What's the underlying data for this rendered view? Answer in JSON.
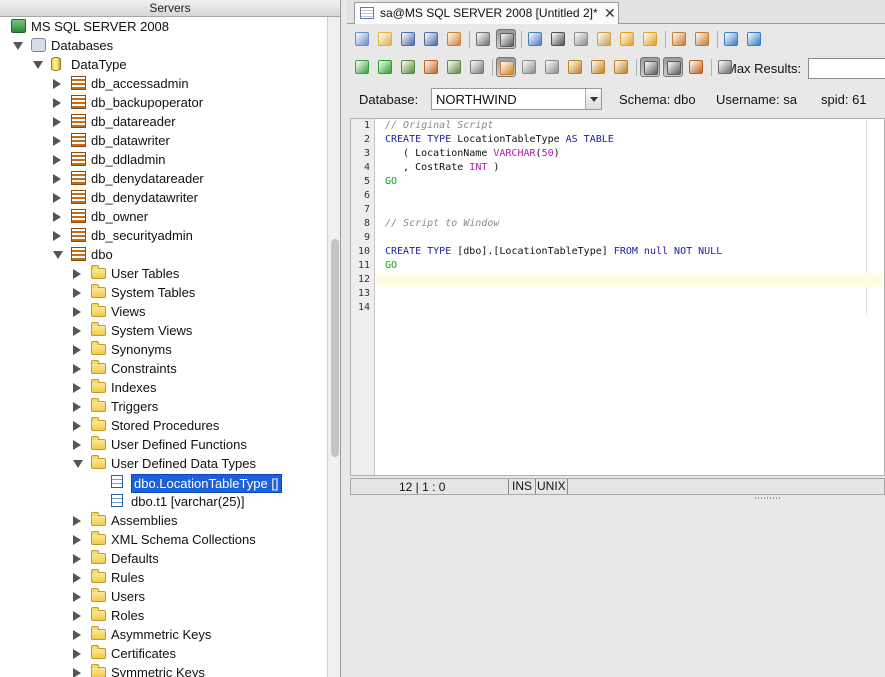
{
  "servers_panel": {
    "title": "Servers",
    "tree": [
      {
        "label": "MS SQL SERVER 2008",
        "level": 0,
        "toggle": "none",
        "icon": "server-icon"
      },
      {
        "label": "Databases",
        "level": 1,
        "toggle": "open",
        "icon": "databases-icon"
      },
      {
        "label": "DataType",
        "level": 2,
        "toggle": "open",
        "icon": "database-icon"
      },
      {
        "label": "db_accessadmin",
        "level": 3,
        "toggle": "closed",
        "icon": "schema-icon"
      },
      {
        "label": "db_backupoperator",
        "level": 3,
        "toggle": "closed",
        "icon": "schema-icon"
      },
      {
        "label": "db_datareader",
        "level": 3,
        "toggle": "closed",
        "icon": "schema-icon"
      },
      {
        "label": "db_datawriter",
        "level": 3,
        "toggle": "closed",
        "icon": "schema-icon"
      },
      {
        "label": "db_ddladmin",
        "level": 3,
        "toggle": "closed",
        "icon": "schema-icon"
      },
      {
        "label": "db_denydatareader",
        "level": 3,
        "toggle": "closed",
        "icon": "schema-icon"
      },
      {
        "label": "db_denydatawriter",
        "level": 3,
        "toggle": "closed",
        "icon": "schema-icon"
      },
      {
        "label": "db_owner",
        "level": 3,
        "toggle": "closed",
        "icon": "schema-icon"
      },
      {
        "label": "db_securityadmin",
        "level": 3,
        "toggle": "closed",
        "icon": "schema-icon"
      },
      {
        "label": "dbo",
        "level": 3,
        "toggle": "open",
        "icon": "schema-icon"
      },
      {
        "label": "User Tables",
        "level": 4,
        "toggle": "closed",
        "icon": "folder-icon"
      },
      {
        "label": "System Tables",
        "level": 4,
        "toggle": "closed",
        "icon": "folder-icon"
      },
      {
        "label": "Views",
        "level": 4,
        "toggle": "closed",
        "icon": "folder-icon"
      },
      {
        "label": "System Views",
        "level": 4,
        "toggle": "closed",
        "icon": "folder-icon"
      },
      {
        "label": "Synonyms",
        "level": 4,
        "toggle": "closed",
        "icon": "folder-icon"
      },
      {
        "label": "Constraints",
        "level": 4,
        "toggle": "closed",
        "icon": "folder-icon"
      },
      {
        "label": "Indexes",
        "level": 4,
        "toggle": "closed",
        "icon": "folder-icon"
      },
      {
        "label": "Triggers",
        "level": 4,
        "toggle": "closed",
        "icon": "folder-icon"
      },
      {
        "label": "Stored Procedures",
        "level": 4,
        "toggle": "closed",
        "icon": "folder-icon"
      },
      {
        "label": "User Defined Functions",
        "level": 4,
        "toggle": "closed",
        "icon": "folder-icon"
      },
      {
        "label": "User Defined Data Types",
        "level": 4,
        "toggle": "open",
        "icon": "folder-icon"
      },
      {
        "label": "dbo.LocationTableType []",
        "level": 5,
        "toggle": "none",
        "icon": "data-type-icon",
        "selected": true
      },
      {
        "label": "dbo.t1 [varchar(25)]",
        "level": 5,
        "toggle": "none",
        "icon": "data-type-icon"
      },
      {
        "label": "Assemblies",
        "level": 4,
        "toggle": "closed",
        "icon": "folder-icon"
      },
      {
        "label": "XML Schema Collections",
        "level": 4,
        "toggle": "closed",
        "icon": "folder-icon"
      },
      {
        "label": "Defaults",
        "level": 4,
        "toggle": "closed",
        "icon": "folder-icon"
      },
      {
        "label": "Rules",
        "level": 4,
        "toggle": "closed",
        "icon": "folder-icon"
      },
      {
        "label": "Users",
        "level": 4,
        "toggle": "closed",
        "icon": "folder-icon"
      },
      {
        "label": "Roles",
        "level": 4,
        "toggle": "closed",
        "icon": "folder-icon"
      },
      {
        "label": "Asymmetric Keys",
        "level": 4,
        "toggle": "closed",
        "icon": "folder-icon"
      },
      {
        "label": "Certificates",
        "level": 4,
        "toggle": "closed",
        "icon": "folder-icon"
      },
      {
        "label": "Symmetric Keys",
        "level": 4,
        "toggle": "closed",
        "icon": "folder-icon"
      }
    ]
  },
  "editor_tab": {
    "label": "sa@MS SQL SERVER 2008 [Untitled 2]*",
    "close": "✕"
  },
  "toolbar": {
    "row1": [
      {
        "name": "new-script-icon",
        "color": "#6a8fc8"
      },
      {
        "name": "open-file-icon",
        "color": "#e0b040"
      },
      {
        "name": "save-icon",
        "color": "#4a6aa8"
      },
      {
        "name": "save-as-icon",
        "color": "#4a6aa8"
      },
      {
        "name": "save-all-icon",
        "color": "#d08030"
      },
      {
        "sep": true
      },
      {
        "name": "print-icon",
        "color": "#707070"
      },
      {
        "name": "toggle-panel-icon",
        "color": "#5a5a5a",
        "pressed": true
      },
      {
        "sep": true
      },
      {
        "name": "select-icon",
        "color": "#4a7ac8"
      },
      {
        "name": "cut-icon",
        "color": "#505050"
      },
      {
        "name": "copy-icon",
        "color": "#8a8a8a"
      },
      {
        "name": "paste-icon",
        "color": "#c8a050"
      },
      {
        "name": "undo-icon",
        "color": "#e0a020"
      },
      {
        "name": "redo-icon",
        "color": "#e0a020"
      },
      {
        "sep": true
      },
      {
        "name": "find-icon",
        "color": "#c87830"
      },
      {
        "name": "replace-icon",
        "color": "#c87830"
      },
      {
        "sep": true
      },
      {
        "name": "format-sql-icon",
        "color": "#3a7ac8"
      },
      {
        "name": "unformat-sql-icon",
        "color": "#3a7ac8"
      }
    ],
    "row2": [
      {
        "name": "execute-step-icon",
        "color": "#3aa03a"
      },
      {
        "name": "run-icon",
        "color": "#2aa02a"
      },
      {
        "name": "run-explain-icon",
        "color": "#5a8a3a"
      },
      {
        "name": "export-icon",
        "color": "#c06020"
      },
      {
        "name": "execute-export-icon",
        "color": "#608a40"
      },
      {
        "name": "stop-icon",
        "color": "#7a7a7a"
      },
      {
        "sep": true
      },
      {
        "name": "auto-commit-icon",
        "color": "#d08020",
        "pressed": true
      },
      {
        "name": "previous-icon",
        "color": "#8a8a8a"
      },
      {
        "name": "next-icon",
        "color": "#8a8a8a"
      },
      {
        "name": "commit-icon",
        "color": "#c08020"
      },
      {
        "name": "rollback-icon",
        "color": "#c08020"
      },
      {
        "name": "history-icon",
        "color": "#c08020"
      },
      {
        "sep": true
      },
      {
        "name": "grid-results-icon",
        "color": "#5a5a5a",
        "pressed": true
      },
      {
        "name": "text-results-icon",
        "color": "#5a5a5a",
        "pressed": true
      },
      {
        "name": "results-panel-icon",
        "color": "#c06020"
      },
      {
        "sep": true
      },
      {
        "name": "query-builder-icon",
        "color": "#6a6a6a"
      }
    ],
    "max_results_label": "Max Results:",
    "max_results_value": ""
  },
  "database_bar": {
    "database_label": "Database:",
    "database_value": "NORTHWIND",
    "schema": "Schema: dbo",
    "username": "Username: sa",
    "spid": "spid: 61"
  },
  "editor": {
    "current_line": 12,
    "lines": [
      [
        {
          "t": "// Original Script",
          "c": "com"
        }
      ],
      [
        {
          "t": "CREATE TYPE",
          "c": "kw"
        },
        {
          "t": " LocationTableType ",
          "c": ""
        },
        {
          "t": "AS TABLE",
          "c": "kw"
        }
      ],
      [
        {
          "t": "   ( LocationName ",
          "c": ""
        },
        {
          "t": "VARCHAR",
          "c": "num"
        },
        {
          "t": "(",
          "c": ""
        },
        {
          "t": "50",
          "c": "num"
        },
        {
          "t": ")",
          "c": ""
        }
      ],
      [
        {
          "t": "   , CostRate ",
          "c": ""
        },
        {
          "t": "INT",
          "c": "num"
        },
        {
          "t": " )",
          "c": ""
        }
      ],
      [
        {
          "t": "GO",
          "c": "green"
        }
      ],
      [],
      [],
      [
        {
          "t": "// Script to Window",
          "c": "com"
        }
      ],
      [],
      [
        {
          "t": "CREATE TYPE",
          "c": "kw"
        },
        {
          "t": " [dbo].[LocationTableType] ",
          "c": ""
        },
        {
          "t": "FROM",
          "c": "kw"
        },
        {
          "t": " ",
          "c": ""
        },
        {
          "t": "null",
          "c": "kw"
        },
        {
          "t": " ",
          "c": ""
        },
        {
          "t": "NOT NULL",
          "c": "kw"
        }
      ],
      [
        {
          "t": "GO",
          "c": "green"
        }
      ],
      [],
      [],
      []
    ]
  },
  "status_bar": {
    "position": "12 | 1 : 0",
    "insert_mode": "INS",
    "line_ending": "UNIX"
  }
}
